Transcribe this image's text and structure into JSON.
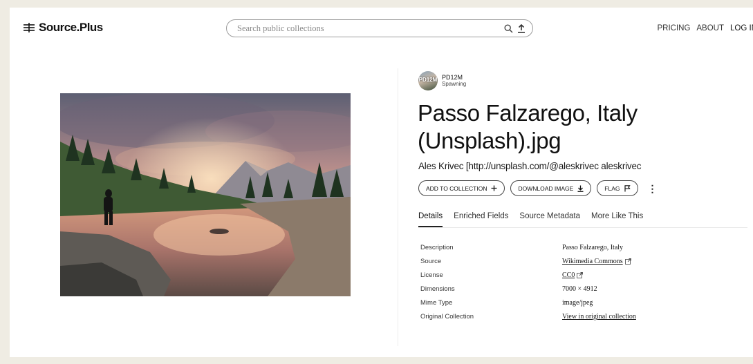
{
  "header": {
    "brand": "Source.Plus",
    "search_placeholder": "Search public collections",
    "nav": [
      "PRICING",
      "ABOUT",
      "LOG IN"
    ]
  },
  "image": {
    "alt": "Passo Falzarego, Italy (Unsplash).jpg"
  },
  "collection": {
    "avatar_text": "PD12M",
    "name": "PD12M",
    "org": "Spawning"
  },
  "title": "Passo Falzarego, Italy (Unsplash).jpg",
  "author": "Ales Krivec [http://unsplash.com/@aleskrivec aleskrivec",
  "actions": {
    "add_to_collection": "ADD TO COLLECTION",
    "download_image": "DOWNLOAD IMAGE",
    "flag": "FLAG"
  },
  "tabs": [
    "Details",
    "Enriched Fields",
    "Source Metadata",
    "More Like This"
  ],
  "fields": [
    {
      "label": "Description",
      "value": "Passo Falzarego, Italy"
    },
    {
      "label": "Source",
      "value": "Wikimedia Commons"
    },
    {
      "label": "License",
      "value": "CC0"
    },
    {
      "label": "Dimensions",
      "value": "7000 × 4912"
    },
    {
      "label": "Mime Type",
      "value": "image/jpeg"
    },
    {
      "label": "Original Collection",
      "value": "View in original collection"
    }
  ],
  "colors": {
    "page_bg": "#efece3",
    "panel_bg": "#ffffff",
    "text": "#1a1a1a"
  }
}
